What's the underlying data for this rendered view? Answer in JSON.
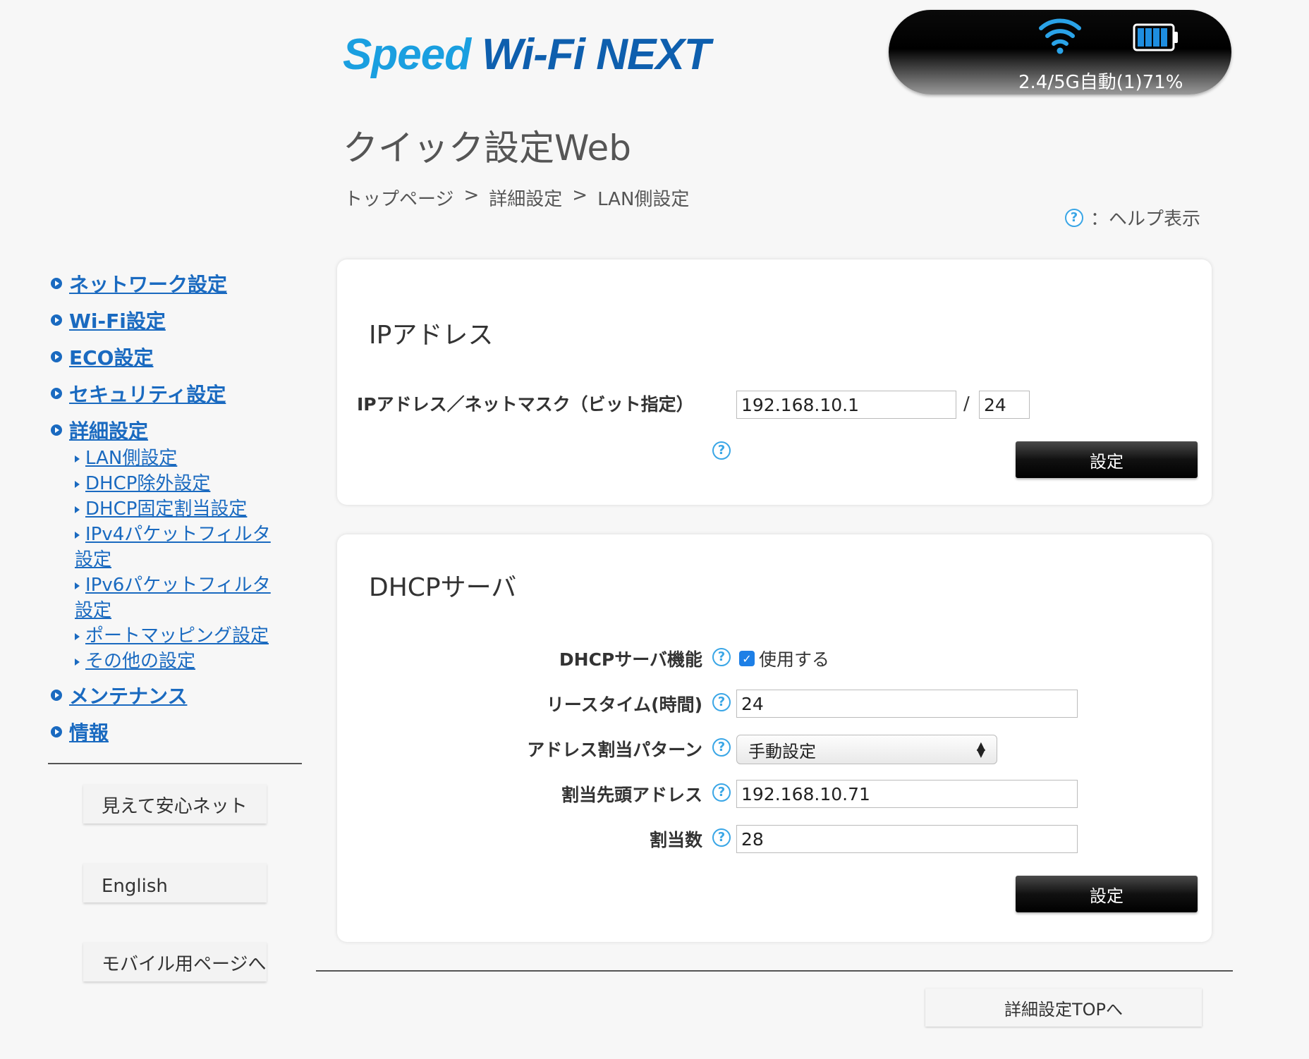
{
  "header": {
    "logo_part1": "Speed",
    "logo_part2": "Wi-Fi NEXT",
    "status_text": "2.4/5G自動(1)71%",
    "wifi_icon": "wifi-signal-icon",
    "battery_icon": "battery-icon",
    "app_title": "クイック設定Web",
    "breadcrumb": [
      "トップページ",
      ">",
      "詳細設定",
      ">",
      "LAN側設定"
    ],
    "help_legend": "：ヘルプ表示",
    "help_glyph": "?"
  },
  "sidebar": {
    "items": [
      {
        "label": "ネットワーク設定"
      },
      {
        "label": "Wi-Fi設定"
      },
      {
        "label": "ECO設定"
      },
      {
        "label": "セキュリティ設定"
      },
      {
        "label": "詳細設定"
      },
      {
        "label": "メンテナンス"
      },
      {
        "label": "情報"
      }
    ],
    "sub_items": [
      "LAN側設定",
      "DHCP除外設定",
      "DHCP固定割当設定",
      "IPv4パケットフィルタ設定",
      "IPv6パケットフィルタ設定",
      "ポートマッピング設定",
      "その他の設定"
    ],
    "buttons": [
      "見えて安心ネット",
      "English",
      "モバイル用ページへ"
    ]
  },
  "ip_panel": {
    "title": "IPアドレス",
    "field_label": "IPアドレス／ネットマスク（ビット指定）",
    "ip_value": "192.168.10.1",
    "separator": "/",
    "mask_value": "24",
    "set_button": "設定"
  },
  "dhcp_panel": {
    "title": "DHCPサーバ",
    "function_label": "DHCPサーバ機能",
    "function_checkbox_label": "使用する",
    "function_checked": true,
    "lease_label": "リースタイム(時間)",
    "lease_value": "24",
    "pattern_label": "アドレス割当パターン",
    "pattern_value": "手動設定",
    "start_label": "割当先頭アドレス",
    "start_value": "192.168.10.71",
    "count_label": "割当数",
    "count_value": "28",
    "set_button": "設定"
  },
  "footer": {
    "top_button": "詳細設定TOPへ"
  },
  "colors": {
    "link": "#1a6ac0",
    "help_icon": "#3aa6e6",
    "logo_light": "#1a9fe0",
    "logo_dark": "#0e5fae"
  }
}
